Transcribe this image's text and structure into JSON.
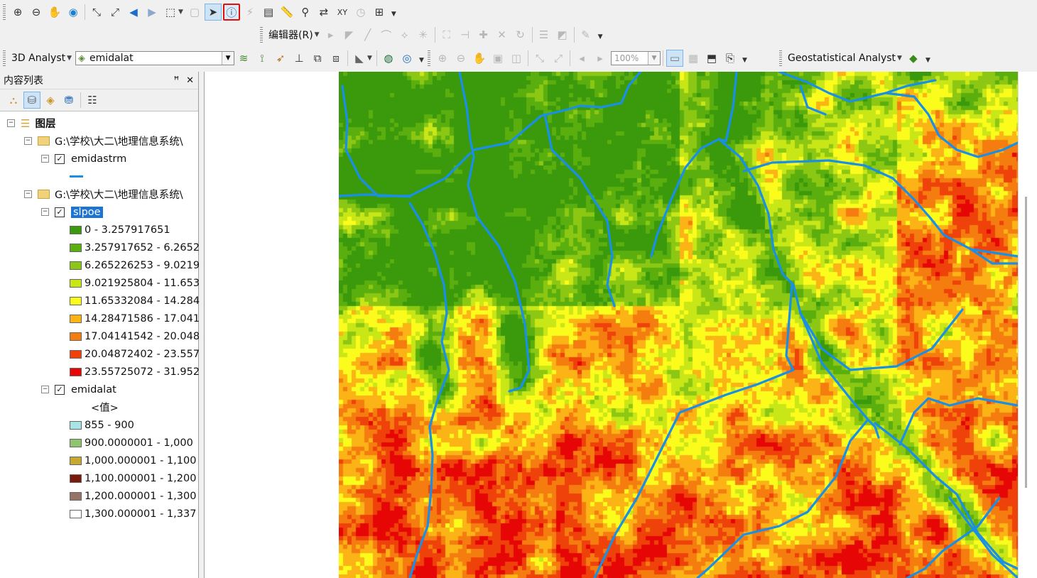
{
  "toolbar2": {
    "editor_label": "编辑器(R)"
  },
  "toolbar3": {
    "analyst3d_label": "3D Analyst",
    "layer_combo_value": "emidalat",
    "zoom_value": "100%",
    "geostat_label": "Geostatistical Analyst"
  },
  "toc": {
    "title": "内容列表",
    "root_label": "图层",
    "group1_path": "G:\\学校\\大二\\地理信息系统\\",
    "layer_emidastrm": "emidastrm",
    "group2_path": "G:\\学校\\大二\\地理信息系统\\",
    "layer_slope": "slpoe",
    "slope_classes": [
      {
        "label": "0 - 3.257917651",
        "color": "#3a9a0c"
      },
      {
        "label": "3.257917652 - 6.2652",
        "color": "#5aaf0e"
      },
      {
        "label": "6.265226253 - 9.0219",
        "color": "#8cc813"
      },
      {
        "label": "9.021925804 - 11.653",
        "color": "#c9e617"
      },
      {
        "label": "11.65332084 - 14.284",
        "color": "#fbfb1c"
      },
      {
        "label": "14.28471586 - 17.041",
        "color": "#fbb315"
      },
      {
        "label": "17.04141542 - 20.048",
        "color": "#f57d0f"
      },
      {
        "label": "20.04872402 - 23.557",
        "color": "#ef420a"
      },
      {
        "label": "23.55725072 - 31.952",
        "color": "#e60606"
      }
    ],
    "layer_emidalat": "emidalat",
    "emidalat_value_heading": "<值>",
    "emidalat_classes": [
      {
        "label": "855 - 900",
        "color": "#a8e3e6"
      },
      {
        "label": "900.0000001 - 1,000",
        "color": "#8dc46d"
      },
      {
        "label": "1,000.000001 - 1,100",
        "color": "#c6a934"
      },
      {
        "label": "1,100.000001 - 1,200",
        "color": "#7a1a0c"
      },
      {
        "label": "1,200.000001 - 1,300",
        "color": "#957467"
      },
      {
        "label": "1,300.000001 - 1,337",
        "color": "#ffffff"
      }
    ]
  },
  "map": {
    "stream_color": "#1a8fe6"
  }
}
